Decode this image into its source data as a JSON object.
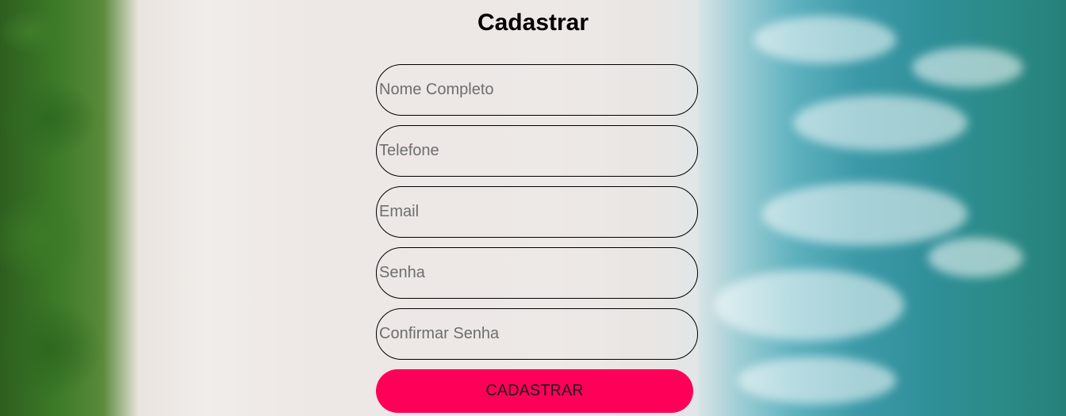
{
  "form": {
    "title": "Cadastrar",
    "fields": [
      {
        "placeholder": "Nome Completo"
      },
      {
        "placeholder": "Telefone"
      },
      {
        "placeholder": "Email"
      },
      {
        "placeholder": "Senha"
      },
      {
        "placeholder": "Confirmar Senha"
      }
    ],
    "submit_label": "CADASTRAR"
  },
  "colors": {
    "submit_button": "#ff0059"
  }
}
